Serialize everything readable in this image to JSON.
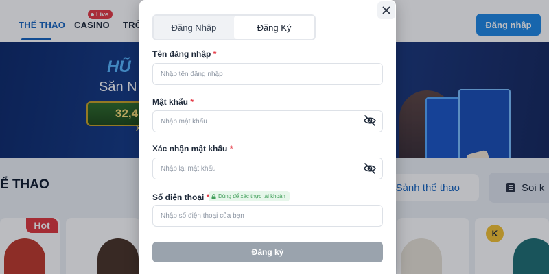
{
  "nav": {
    "items": [
      "THỂ THAO",
      "CASINO",
      "TRÒ"
    ],
    "live_badge": "Live",
    "login_button": "Đăng nhập"
  },
  "banner": {
    "title": "HŨ",
    "subtitle": "Săn N",
    "jackpot": "32,4",
    "jackpot_suffix": "X"
  },
  "sports_section": {
    "title": "Ể THAO",
    "tab_lobby": "Sảnh thể thao",
    "tab_odds": "Soi k",
    "hot_badge": "Hot",
    "k_badge": "K"
  },
  "modal": {
    "tabs": [
      "Đăng Nhập",
      "Đăng Ký"
    ],
    "active_tab": "Đăng Ký",
    "fields": [
      {
        "label": "Tên đăng nhập",
        "required": "*",
        "placeholder": "Nhập tên đăng nhập",
        "value": ""
      },
      {
        "label": "Mật khẩu",
        "required": "*",
        "placeholder": "Nhập mật khẩu",
        "value": "",
        "icon": "eye-slash-icon"
      },
      {
        "label": "Xác nhận mật khẩu",
        "required": "*",
        "placeholder": "Nhập lại mật khẩu",
        "value": "",
        "icon": "eye-slash-icon"
      },
      {
        "label": "Số điện thoại",
        "required": "*",
        "placeholder": "Nhập số điện thoại của bạn",
        "value": ""
      }
    ],
    "verify_note": "Dùng để xác thực tài khoản",
    "submit_button": "Đăng ký",
    "close_icon": "close-icon"
  },
  "colors": {
    "brand_blue": "#1e88e5",
    "required_red": "#e53945",
    "submit_disabled": "#9aa3ad",
    "verify_green": "#3f9e58"
  }
}
